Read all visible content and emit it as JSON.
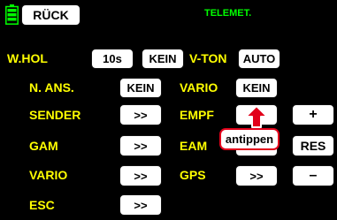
{
  "colors": {
    "label": "#ffff00",
    "title": "#00ff00",
    "accent": "#e2001a",
    "background": "#000000"
  },
  "header": {
    "back_label": "RÜCK",
    "title": "TELEMET."
  },
  "row_whol": {
    "label": "W.HOL",
    "interval": "10s",
    "mode": "KEIN"
  },
  "vton": {
    "label": "V-TON",
    "value": "AUTO"
  },
  "n_ans": {
    "label": "N. ANS.",
    "value": "KEIN"
  },
  "vario_right": {
    "label": "VARIO",
    "value": "KEIN"
  },
  "sender": {
    "label": "SENDER",
    "button": ">>"
  },
  "empf": {
    "label": "EMPF"
  },
  "plus_button": "+",
  "gam": {
    "label": "GAM",
    "button": ">>"
  },
  "eam": {
    "label": "EAM"
  },
  "res_button": "RES",
  "vario_left": {
    "label": "VARIO",
    "button": ">>"
  },
  "gps": {
    "label": "GPS",
    "button": ">>"
  },
  "minus_button": "–",
  "esc": {
    "label": "ESC",
    "button": ">>"
  },
  "hint": {
    "text": "antippen",
    "icon": "arrow-up-icon"
  }
}
